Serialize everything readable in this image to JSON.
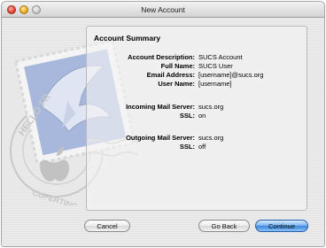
{
  "window": {
    "title": "New Account"
  },
  "panel": {
    "title": "Account Summary",
    "rows": [
      {
        "label": "Account Description:",
        "value": "SUCS Account"
      },
      {
        "label": "Full Name:",
        "value": "SUCS User"
      },
      {
        "label": "Email Address:",
        "value": "[username]@sucs.org"
      },
      {
        "label": "User Name:",
        "value": "[username]"
      },
      {
        "label": "Incoming Mail Server:",
        "value": "sucs.org"
      },
      {
        "label": "SSL:",
        "value": "on"
      },
      {
        "label": "Outgoing Mail Server:",
        "value": "sucs.org"
      },
      {
        "label": "SSL:",
        "value": "off"
      }
    ]
  },
  "buttons": {
    "cancel": "Cancel",
    "back": "Go Back",
    "continue": "Continue"
  },
  "art": {
    "stamp_text_top": "HELLO FR",
    "stamp_text_bottom": "CUPERTINO"
  },
  "colors": {
    "accent": "#3b86dc",
    "stamp": "#7d96c6"
  }
}
